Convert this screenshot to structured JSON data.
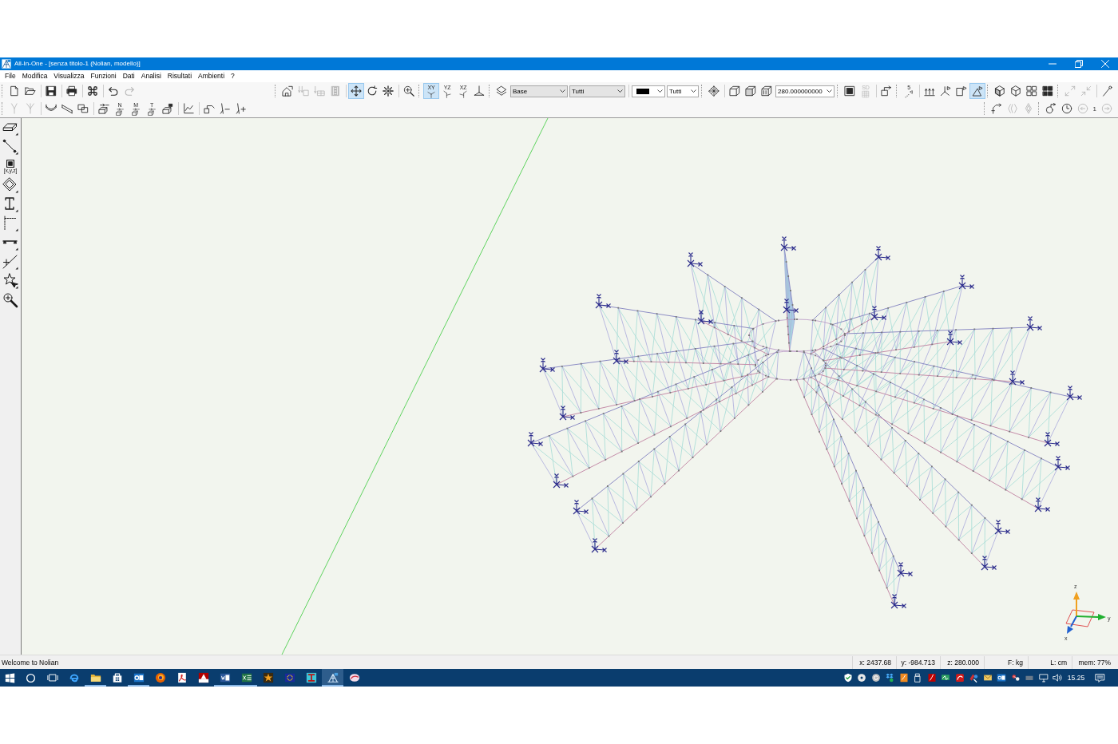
{
  "window": {
    "title": "All-In-One - [senza titolo-1 (Nolian, modello)]"
  },
  "menu": [
    "File",
    "Modifica",
    "Visualizza",
    "Funzioni",
    "Dati",
    "Analisi",
    "Risultati",
    "Ambienti",
    "?"
  ],
  "toolbar_rows": [
    {
      "left": [
        [
          [
            {
              "kind": "button",
              "selected": false,
              "disabled": false
            },
            {
              "kind": "button",
              "selected": false,
              "disabled": false
            }
          ],
          [
            {
              "kind": "button",
              "selected": false,
              "disabled": false
            }
          ],
          [
            {
              "kind": "button",
              "selected": false,
              "disabled": false
            }
          ],
          [
            {
              "kind": "button",
              "selected": false,
              "disabled": false
            }
          ],
          [
            {
              "kind": "button",
              "selected": false,
              "disabled": false
            },
            {
              "kind": "button",
              "selected": false,
              "disabled": true
            }
          ]
        ]
      ],
      "right": [
        [
          [
            {
              "kind": "button",
              "selected": false,
              "disabled": false
            },
            {
              "kind": "button",
              "selected": false,
              "disabled": true
            },
            {
              "kind": "button",
              "selected": false,
              "disabled": true
            },
            {
              "kind": "button",
              "selected": false,
              "disabled": true
            }
          ],
          [
            {
              "kind": "button",
              "selected": true,
              "disabled": false
            },
            {
              "kind": "button",
              "selected": false,
              "disabled": false
            },
            {
              "kind": "button",
              "selected": false,
              "disabled": false
            }
          ],
          [
            {
              "kind": "button",
              "selected": false,
              "disabled": false
            }
          ]
        ],
        [
          [
            {
              "kind": "button",
              "selected": true,
              "disabled": false,
              "caption": "XY"
            },
            {
              "kind": "button",
              "selected": false,
              "disabled": false,
              "caption": "YZ"
            },
            {
              "kind": "button",
              "selected": false,
              "disabled": false,
              "caption": "XZ"
            },
            {
              "kind": "button",
              "selected": false,
              "disabled": false
            }
          ]
        ],
        [
          [
            {
              "kind": "button",
              "selected": false,
              "disabled": false
            },
            {
              "kind": "dropdown",
              "value": "Base",
              "disabled": true
            },
            {
              "kind": "dropdown",
              "value": "Tutti",
              "disabled": true
            }
          ],
          [
            {
              "kind": "color_dropdown",
              "color": "#000000"
            },
            {
              "kind": "dropdown",
              "value": "Tutti",
              "disabled": false
            }
          ]
        ],
        [
          [
            {
              "kind": "button",
              "selected": false,
              "disabled": false
            }
          ],
          [
            {
              "kind": "button",
              "selected": false,
              "disabled": false
            },
            {
              "kind": "button",
              "selected": false,
              "disabled": false
            },
            {
              "kind": "button",
              "selected": false,
              "disabled": false
            },
            {
              "kind": "dropdown",
              "value": "280.000000000",
              "disabled": false
            }
          ]
        ],
        [
          [
            {
              "kind": "button",
              "selected": false,
              "disabled": false
            },
            {
              "kind": "button",
              "selected": false,
              "disabled": true,
              "caption": "SD"
            }
          ],
          [
            {
              "kind": "button",
              "selected": false,
              "disabled": false
            }
          ]
        ],
        [
          [
            {
              "kind": "button",
              "selected": false,
              "disabled": false,
              "caption": "5"
            }
          ],
          [
            {
              "kind": "button",
              "selected": false,
              "disabled": false
            },
            {
              "kind": "button",
              "selected": false,
              "disabled": false
            },
            {
              "kind": "button",
              "selected": false,
              "disabled": false
            },
            {
              "kind": "button",
              "selected": true,
              "disabled": false
            }
          ]
        ],
        [
          [
            {
              "kind": "button",
              "selected": false,
              "disabled": false
            },
            {
              "kind": "button",
              "selected": false,
              "disabled": false
            },
            {
              "kind": "button",
              "selected": false,
              "disabled": false
            },
            {
              "kind": "button",
              "selected": false,
              "disabled": false
            }
          ]
        ],
        [
          [
            {
              "kind": "button",
              "selected": false,
              "disabled": true
            },
            {
              "kind": "button",
              "selected": false,
              "disabled": true
            }
          ],
          [
            {
              "kind": "button",
              "selected": false,
              "disabled": false
            }
          ]
        ]
      ]
    },
    {
      "left": [
        [
          [
            {
              "kind": "button",
              "selected": false,
              "disabled": true
            },
            {
              "kind": "button",
              "selected": false,
              "disabled": true
            }
          ],
          [
            {
              "kind": "button",
              "selected": false,
              "disabled": false
            },
            {
              "kind": "button",
              "selected": false,
              "disabled": false
            },
            {
              "kind": "button",
              "selected": false,
              "disabled": false
            }
          ],
          [
            {
              "kind": "button",
              "selected": false,
              "disabled": false
            },
            {
              "kind": "button",
              "selected": false,
              "disabled": false,
              "caption": "N"
            },
            {
              "kind": "button",
              "selected": false,
              "disabled": false,
              "caption": "M"
            },
            {
              "kind": "button",
              "selected": false,
              "disabled": false,
              "caption": "T"
            },
            {
              "kind": "button",
              "selected": false,
              "disabled": false
            }
          ],
          [
            {
              "kind": "button",
              "selected": false,
              "disabled": false
            }
          ],
          [
            {
              "kind": "button",
              "selected": false,
              "disabled": false
            },
            {
              "kind": "button",
              "selected": false,
              "disabled": false
            },
            {
              "kind": "button",
              "selected": false,
              "disabled": false
            }
          ]
        ]
      ],
      "right": [
        [
          [
            {
              "kind": "button",
              "selected": false,
              "disabled": false
            },
            {
              "kind": "button",
              "selected": false,
              "disabled": true
            },
            {
              "kind": "button",
              "selected": false,
              "disabled": true
            }
          ]
        ],
        [
          [
            {
              "kind": "button",
              "selected": false,
              "disabled": false
            },
            {
              "kind": "button",
              "selected": false,
              "disabled": false
            },
            {
              "kind": "button",
              "selected": false,
              "disabled": true
            },
            {
              "kind": "label",
              "text": "1"
            },
            {
              "kind": "button",
              "selected": false,
              "disabled": true
            }
          ]
        ]
      ]
    }
  ],
  "tool_palette": [
    {
      "selected": false
    },
    {
      "selected": false
    },
    {
      "selected": false,
      "caption": "[x,y,z]"
    },
    {
      "selected": false
    },
    {
      "selected": false
    },
    {
      "selected": false
    },
    {
      "selected": false
    },
    {
      "selected": false
    },
    {
      "selected": false
    },
    {
      "selected": false
    }
  ],
  "axis_indicator": [
    {
      "label": "z",
      "color": "#f0a020"
    },
    {
      "label": "y",
      "color": "#20b030"
    },
    {
      "label": "x",
      "color": "#2060d0"
    }
  ],
  "status_bar": {
    "message": "Welcome to Nolian",
    "panes": [
      "x: 2437.68",
      "y: -984.713",
      "z: 280.000",
      "F: kg",
      "L: cm",
      "mem: 77%"
    ]
  },
  "taskbar": {
    "apps": [
      {
        "open": false,
        "active": false
      },
      {
        "open": true,
        "active": false
      },
      {
        "open": false,
        "active": false
      },
      {
        "open": true,
        "active": false
      },
      {
        "open": false,
        "active": false
      },
      {
        "open": false,
        "active": false
      },
      {
        "open": false,
        "active": false
      },
      {
        "open": true,
        "active": false
      },
      {
        "open": true,
        "active": false
      },
      {
        "open": false,
        "active": false
      },
      {
        "open": false,
        "active": false
      },
      {
        "open": false,
        "active": false
      },
      {
        "open": true,
        "active": true
      },
      {
        "open": false,
        "active": false
      }
    ],
    "clock": "15.25"
  }
}
